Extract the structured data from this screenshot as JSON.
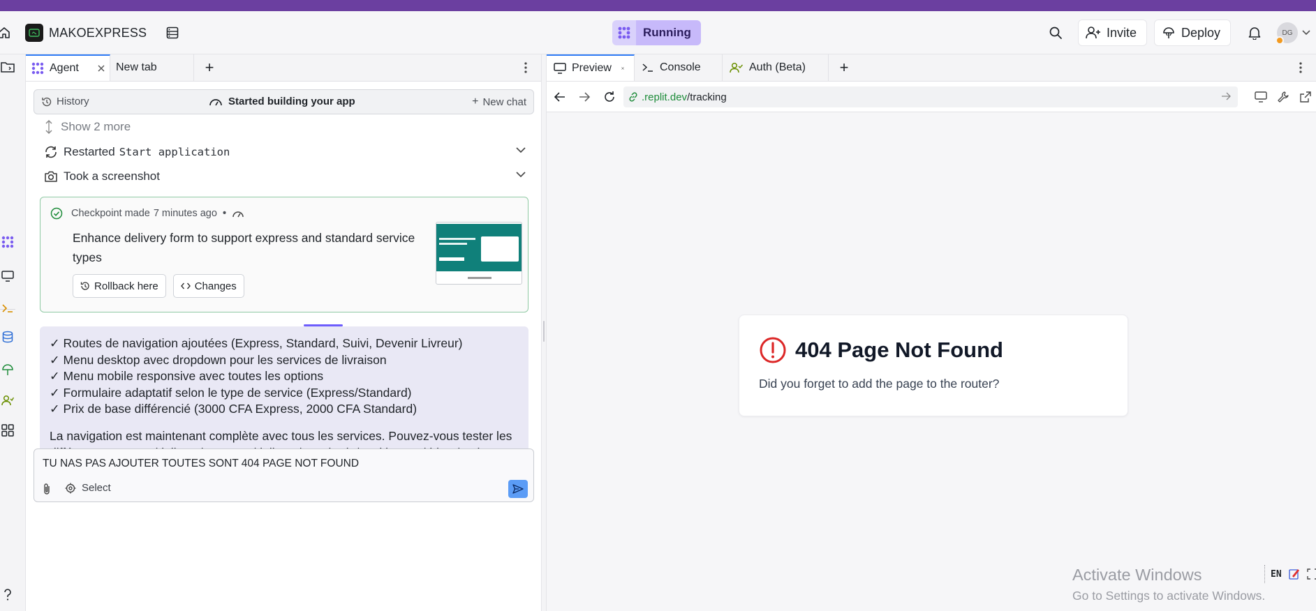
{
  "header": {
    "app_name": "MAKOEXPRESS",
    "status": "Running",
    "invite_label": "Invite",
    "deploy_label": "Deploy",
    "avatar_initials": "DG"
  },
  "left_tabs": {
    "agent": "Agent",
    "new_tab": "New tab",
    "add": "+"
  },
  "history_bar": {
    "history_label": "History",
    "status_label": "Started building your app",
    "new_chat_label": "New chat"
  },
  "feed": {
    "show_more": "Show 2 more",
    "restarted_prefix": "Restarted",
    "restarted_target": "Start application",
    "screenshot_label": "Took a screenshot"
  },
  "checkpoint": {
    "head_prefix": "Checkpoint made",
    "head_time": "7 minutes ago",
    "head_sep": "•",
    "description": "Enhance delivery form to support express and standard service types",
    "rollback_label": "Rollback here",
    "changes_label": "Changes"
  },
  "message": {
    "lines": [
      "✓ Routes de navigation ajoutées (Express, Standard, Suivi, Devenir Livreur)",
      "✓ Menu desktop avec dropdown pour les services de livraison",
      "✓ Menu mobile responsive avec toutes les options",
      "✓ Formulaire adaptatif selon le type de service (Express/Standard)",
      "✓ Prix de base différencié (3000 CFA Express, 2000 CFA Standard)"
    ],
    "paragraph": "La navigation est maintenant complète avec tous les services. Pouvez-vous tester les différentes routes : /delivery/express, /delivery/standard, /tracking, et /driver/register ?"
  },
  "composer": {
    "text": "TU NAS PAS AJOUTER TOUTES SONT 404 PAGE NOT FOUND",
    "select_label": "Select"
  },
  "right_tabs": {
    "preview": "Preview",
    "console": "Console",
    "auth": "Auth (Beta)",
    "add": "+"
  },
  "url": {
    "domain": ".replit.dev",
    "path": "/tracking"
  },
  "not_found": {
    "title": "404 Page Not Found",
    "subtitle": "Did you forget to add the page to the router?"
  },
  "ime": {
    "lang": "EN"
  },
  "watermark": {
    "line1": "Activate Windows",
    "line2": "Go to Settings to activate Windows."
  },
  "colors": {
    "brand_purple": "#6b3fa0",
    "running_pill": "#c7b9fa",
    "checkpoint_border": "#8fc9a3",
    "message_bg": "#e9e8f5",
    "url_domain": "#1e8c3a",
    "error_red": "#dc2626",
    "send_button": "#5b9cf6"
  }
}
